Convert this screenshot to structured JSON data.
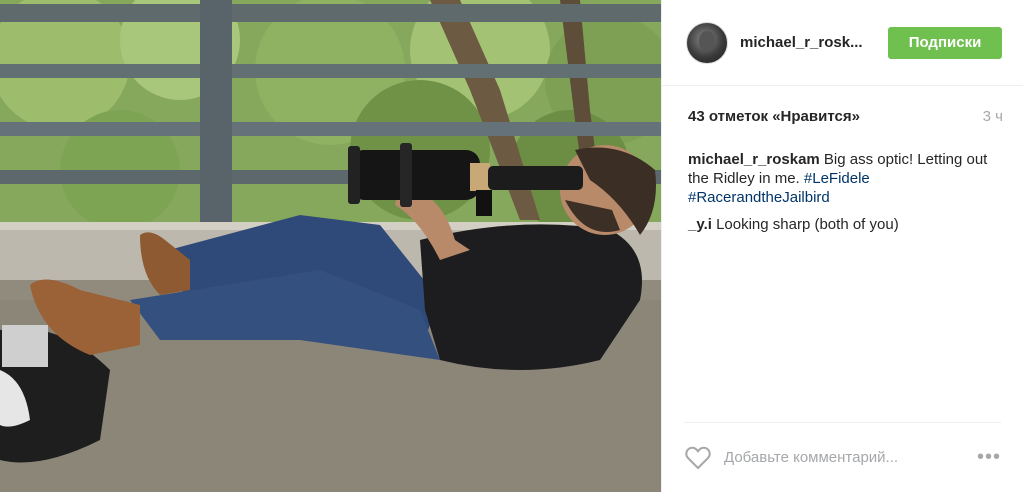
{
  "post": {
    "photo_alt": "",
    "author": {
      "username": "michael_r_rosk..."
    },
    "follow_button": "Подписки",
    "likes": "43 отметок «Нравится»",
    "time": "3 ч",
    "comments": [
      {
        "user": "michael_r_roskam",
        "text": " Big ass optic! Letting out the Ridley in me. ",
        "tags": [
          "#LeFidele",
          "#RacerandtheJailbird"
        ]
      },
      {
        "user": "_y.i",
        "text": " Looking sharp (both of you)",
        "tags": []
      }
    ],
    "add_comment_placeholder": "Добавьте комментарий...",
    "more_label": "•••"
  },
  "colors": {
    "follow_green": "#70c050",
    "hashtag": "#003569",
    "muted": "#a5a7aa"
  }
}
